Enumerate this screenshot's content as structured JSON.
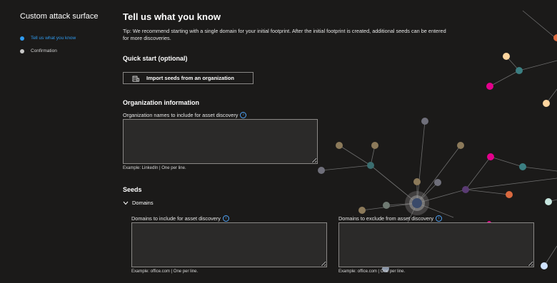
{
  "sidebar": {
    "title": "Custom attack surface",
    "steps": [
      {
        "label": "Tell us what you know",
        "active": true
      },
      {
        "label": "Confirmation",
        "active": false
      }
    ]
  },
  "main": {
    "title": "Tell us what you know",
    "tip": "Tip: We recommend starting with a single domain for your initial footprint. After the initial footprint is created, additional seeds can be entered for more discoveries.",
    "quick_start": {
      "heading": "Quick start (optional)",
      "import_button": "Import seeds from an organization"
    },
    "org_info": {
      "heading": "Organization information",
      "field_label": "Organization names to include for asset discovery",
      "value": "",
      "hint": "Example: LinkedIn | One per line."
    },
    "seeds": {
      "heading": "Seeds",
      "domains_toggle": "Domains",
      "include": {
        "label": "Domains to include for asset discovery",
        "value": "",
        "hint": "Example: office.com | One per line."
      },
      "exclude": {
        "label": "Domains to exclude from asset discovery",
        "value": "",
        "hint": "Example: office.com | One per line."
      }
    }
  },
  "colors": {
    "background": "#1b1a19",
    "accent": "#2f9bf0",
    "input_bg": "#2b2a29",
    "input_border": "#8a8886",
    "node_colors": [
      "#ffd59e",
      "#e3008c",
      "#3b7f82",
      "#6b5b95",
      "#d9693f",
      "#7a7a7a",
      "#8c7a5a",
      "#c7e6df",
      "#cfe3ff",
      "#5a3b73"
    ]
  },
  "icons": {
    "step_indicator": "dot-icon",
    "import": "building-icon",
    "info": "info-icon",
    "expand": "chevron-down-icon"
  }
}
